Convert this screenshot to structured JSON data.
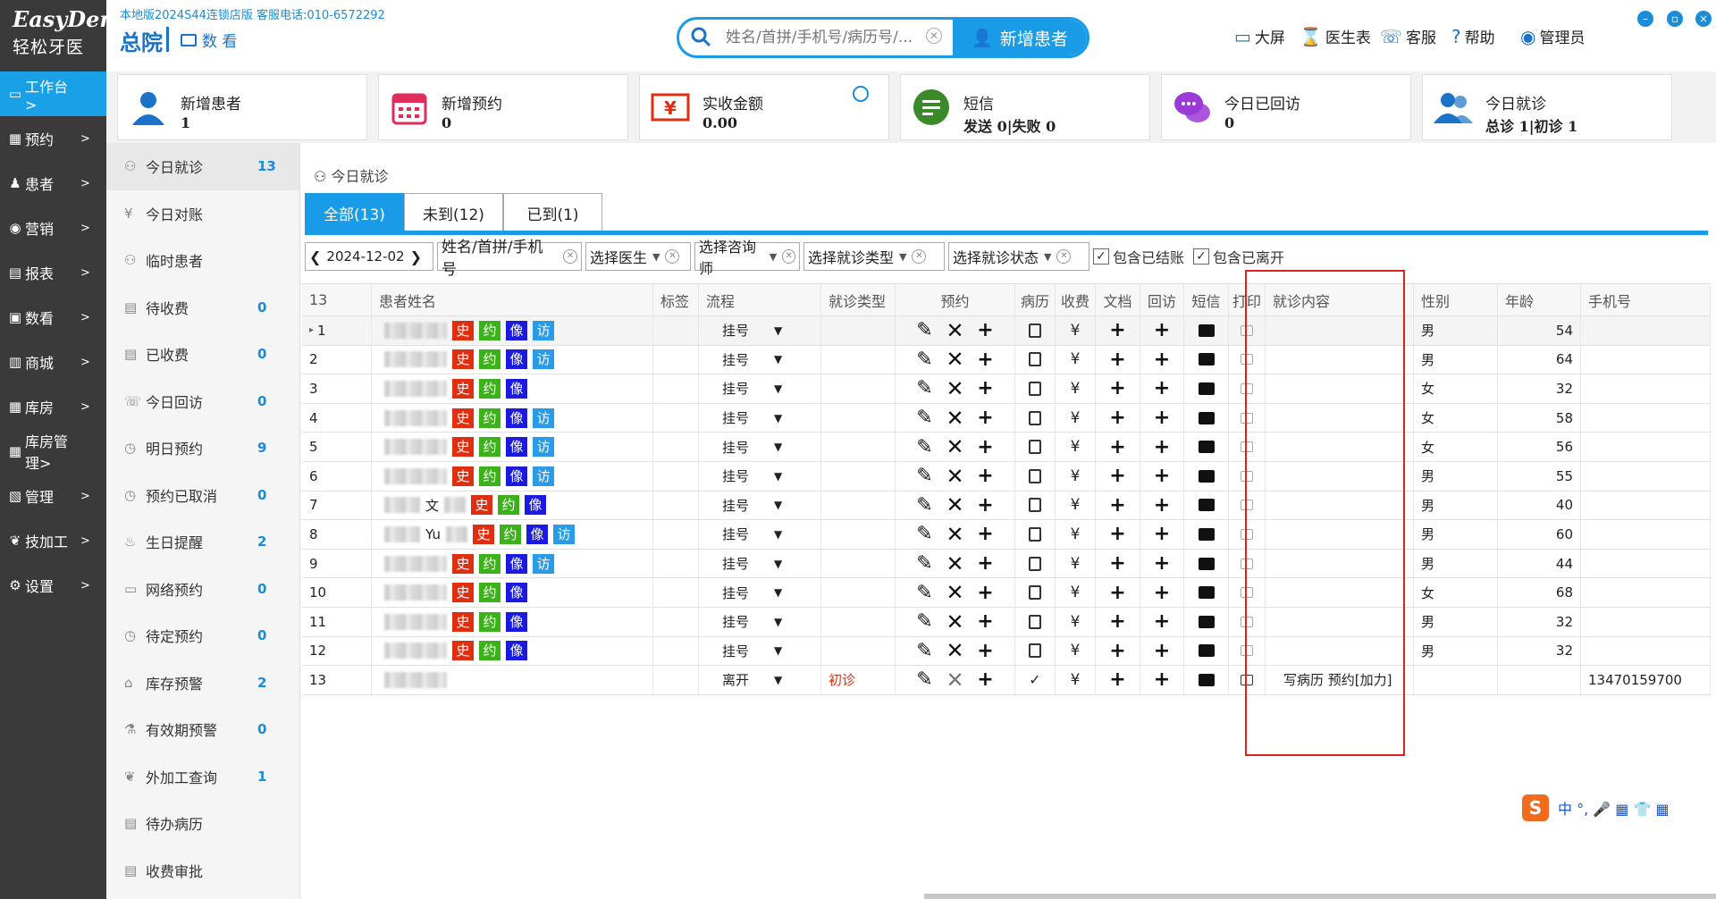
{
  "app": {
    "logo_line1": "EasyDent",
    "logo_line2": "轻松牙医",
    "topline": "本地版2024S44连锁店版 客服电话:010-6572292",
    "branch": "总院",
    "shuzhan": "数 看"
  },
  "search": {
    "placeholder": "姓名/首拼/手机号/病历号/...",
    "new_patient": "新增患者"
  },
  "header_links": [
    "大屏",
    "医生表",
    "客服",
    "帮助",
    "管理员"
  ],
  "nav": [
    {
      "icon": "▭",
      "label": "工作台 >",
      "active": true
    },
    {
      "icon": "▦",
      "label": "预约",
      "active": false
    },
    {
      "icon": "♟",
      "label": "患者",
      "active": false
    },
    {
      "icon": "◉",
      "label": "营销",
      "active": false
    },
    {
      "icon": "▤",
      "label": "报表",
      "active": false
    },
    {
      "icon": "▣",
      "label": "数看",
      "active": false
    },
    {
      "icon": "▥",
      "label": "商城",
      "active": false
    },
    {
      "icon": "▦",
      "label": "库房",
      "active": false
    },
    {
      "icon": "▦",
      "label": "库房管理>",
      "active": false
    },
    {
      "icon": "▧",
      "label": "管理",
      "active": false
    },
    {
      "icon": "❦",
      "label": "技加工",
      "active": false
    },
    {
      "icon": "⚙",
      "label": "设置",
      "active": false
    }
  ],
  "stats": [
    {
      "title": "新增患者",
      "value": "1",
      "color": "#1a73c8",
      "icon": "user-icon"
    },
    {
      "title": "新增预约",
      "value": "0",
      "color": "#e02e5a",
      "icon": "calendar-icon"
    },
    {
      "title": "实收金额",
      "value": "0.00",
      "color": "#e02e10",
      "icon": "money-icon"
    },
    {
      "title": "短信",
      "value": "发送 0|失败 0",
      "color": "#3a8a2a",
      "icon": "sms-icon"
    },
    {
      "title": "今日已回访",
      "value": "0",
      "color": "#9b3ad8",
      "icon": "chat-icon"
    },
    {
      "title": "今日就诊",
      "value": "总诊 1|初诊 1",
      "color": "#1a73c8",
      "icon": "users-icon"
    }
  ],
  "sub_sidebar": [
    {
      "label": "今日就诊",
      "count": "13",
      "active": true
    },
    {
      "label": "今日对账",
      "count": ""
    },
    {
      "label": "临时患者",
      "count": ""
    },
    {
      "label": "待收费",
      "count": "0"
    },
    {
      "label": "已收费",
      "count": "0"
    },
    {
      "label": "今日回访",
      "count": "0"
    },
    {
      "label": "明日预约",
      "count": "9"
    },
    {
      "label": "预约已取消",
      "count": "0"
    },
    {
      "label": "生日提醒",
      "count": "2"
    },
    {
      "label": "网络预约",
      "count": "0"
    },
    {
      "label": "待定预约",
      "count": "0"
    },
    {
      "label": "库存预警",
      "count": "2"
    },
    {
      "label": "有效期预警",
      "count": "0"
    },
    {
      "label": "外加工查询",
      "count": "1"
    },
    {
      "label": "待办病历",
      "count": ""
    },
    {
      "label": "收费审批",
      "count": ""
    }
  ],
  "breadcrumb": "今日就诊",
  "tabs": [
    "全部(13)",
    "未到(12)",
    "已到(1)"
  ],
  "filters": {
    "date": "2024-12-02",
    "name_placeholder": "姓名/首拼/手机号",
    "doctor": "选择医生",
    "consultant": "选择咨询师",
    "visit_type": "选择就诊类型",
    "visit_status": "选择就诊状态",
    "include_settled": "包含已结账",
    "include_left": "包含已离开"
  },
  "columns": [
    "13",
    "患者姓名",
    "标签",
    "流程",
    "就诊类型",
    "预约",
    "病历",
    "收费",
    "文档",
    "回访",
    "短信",
    "打印",
    "就诊内容",
    "性别",
    "年龄",
    "手机号"
  ],
  "rows": [
    {
      "no": "1",
      "name_hint": "",
      "tags": [
        "史",
        "约",
        "像",
        "访"
      ],
      "flow": "挂号",
      "visit_type": "",
      "content": "",
      "sex": "男",
      "age": "54",
      "phone": "",
      "current": true
    },
    {
      "no": "2",
      "name_hint": "",
      "tags": [
        "史",
        "约",
        "像",
        "访"
      ],
      "flow": "挂号",
      "visit_type": "",
      "content": "",
      "sex": "男",
      "age": "64",
      "phone": ""
    },
    {
      "no": "3",
      "name_hint": "",
      "tags": [
        "史",
        "约",
        "像"
      ],
      "flow": "挂号",
      "visit_type": "",
      "content": "",
      "sex": "女",
      "age": "32",
      "phone": ""
    },
    {
      "no": "4",
      "name_hint": "",
      "tags": [
        "史",
        "约",
        "像",
        "访"
      ],
      "flow": "挂号",
      "visit_type": "",
      "content": "",
      "sex": "女",
      "age": "58",
      "phone": ""
    },
    {
      "no": "5",
      "name_hint": "",
      "tags": [
        "史",
        "约",
        "像",
        "访"
      ],
      "flow": "挂号",
      "visit_type": "",
      "content": "",
      "sex": "女",
      "age": "56",
      "phone": ""
    },
    {
      "no": "6",
      "name_hint": "",
      "tags": [
        "史",
        "约",
        "像",
        "访"
      ],
      "flow": "挂号",
      "visit_type": "",
      "content": "",
      "sex": "男",
      "age": "55",
      "phone": ""
    },
    {
      "no": "7",
      "name_hint": "文",
      "tags": [
        "史",
        "约",
        "像"
      ],
      "flow": "挂号",
      "visit_type": "",
      "content": "",
      "sex": "男",
      "age": "40",
      "phone": ""
    },
    {
      "no": "8",
      "name_hint": "Yu",
      "tags": [
        "史",
        "约",
        "像",
        "访"
      ],
      "flow": "挂号",
      "visit_type": "",
      "content": "",
      "sex": "男",
      "age": "60",
      "phone": ""
    },
    {
      "no": "9",
      "name_hint": "",
      "tags": [
        "史",
        "约",
        "像",
        "访"
      ],
      "flow": "挂号",
      "visit_type": "",
      "content": "",
      "sex": "男",
      "age": "44",
      "phone": ""
    },
    {
      "no": "10",
      "name_hint": "",
      "tags": [
        "史",
        "约",
        "像"
      ],
      "flow": "挂号",
      "visit_type": "",
      "content": "",
      "sex": "女",
      "age": "68",
      "phone": ""
    },
    {
      "no": "11",
      "name_hint": "",
      "tags": [
        "史",
        "约",
        "像"
      ],
      "flow": "挂号",
      "visit_type": "",
      "content": "",
      "sex": "男",
      "age": "32",
      "phone": ""
    },
    {
      "no": "12",
      "name_hint": "",
      "tags": [
        "史",
        "约",
        "像"
      ],
      "flow": "挂号",
      "visit_type": "",
      "content": "",
      "sex": "男",
      "age": "32",
      "phone": ""
    },
    {
      "no": "13",
      "name_hint": "",
      "tags": [],
      "flow": "离开",
      "visit_type": "初诊",
      "content": "写病历 预约[加力]",
      "sex": "",
      "age": "",
      "phone": "13470159700",
      "left": true
    }
  ],
  "ime": "中 °, 🎤 ▦ 👕 ▦"
}
